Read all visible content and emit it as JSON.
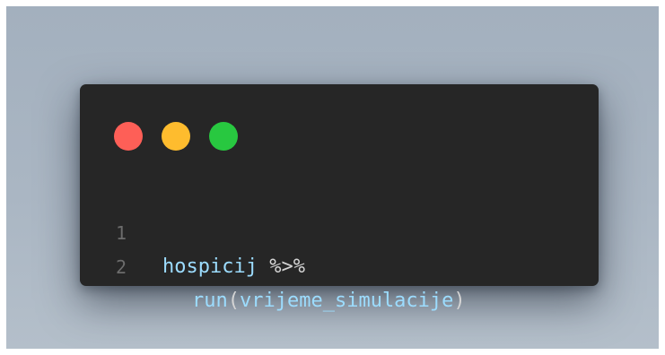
{
  "window": {
    "controls": [
      {
        "name": "close-dot",
        "color": "#fe5f57"
      },
      {
        "name": "minimize-dot",
        "color": "#febc2e"
      },
      {
        "name": "zoom-dot",
        "color": "#28c840"
      }
    ]
  },
  "code": {
    "lines": [
      {
        "number": "1",
        "ident": "hospicij",
        "op": " %>%"
      },
      {
        "number": "2",
        "fn": "run",
        "paren_open": "(",
        "arg": "vrijeme_simulacije",
        "paren_close": ")"
      }
    ]
  },
  "colors": {
    "background": "#a8b4c1",
    "editor": "#262626",
    "identifier": "#9cdcfe",
    "operator": "#d4d4d4",
    "line_number": "#6c6c6c"
  }
}
